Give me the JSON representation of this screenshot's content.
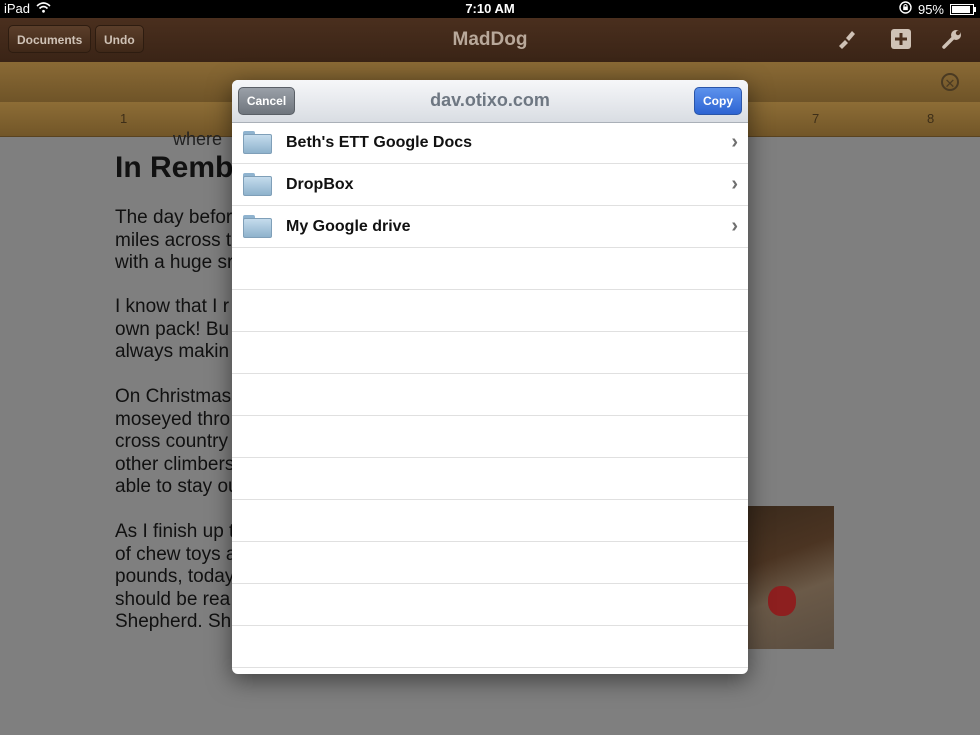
{
  "status_bar": {
    "device": "iPad",
    "time": "7:10 AM",
    "battery": "95%"
  },
  "toolbar": {
    "documents_label": "Documents",
    "undo_label": "Undo",
    "title": "MadDog"
  },
  "ruler": {
    "numbers": [
      "1",
      "7",
      "8"
    ]
  },
  "document": {
    "partial_top": "where",
    "heading": "In Rembo",
    "paragraphs": [
      "The day befor                                                   walked six\nmiles across t                                                   at full sprint\nwith a huge sr",
      "I know that I r                                                    carry her\nown pack! Bu                                                    r critters and\nalways makin",
      "On Christmas                                                   We started\nmoseyed thro                                                   e outings,\ncross country                                                   wever, like\nother climbers                                                  e wouldn’t be\nable to stay ou",
      "As I finish up t\nof chew toys a\npounds, today\nshould be rea\nShepherd. Sh"
    ]
  },
  "modal": {
    "title": "dav.otixo.com",
    "cancel_label": "Cancel",
    "copy_label": "Copy",
    "folders": [
      {
        "name": "Beth's ETT Google Docs"
      },
      {
        "name": "DropBox"
      },
      {
        "name": "My Google drive"
      }
    ],
    "empty_rows": 10
  },
  "colors": {
    "copy_button": "#2d64d3",
    "toolbar": "#3a2416",
    "ruler": "#8d6d36"
  },
  "icons": {
    "toolbar": [
      "brush-icon",
      "plus-icon",
      "wrench-icon"
    ],
    "row": "folder-icon",
    "row_chevron": "chevron-right-icon"
  }
}
